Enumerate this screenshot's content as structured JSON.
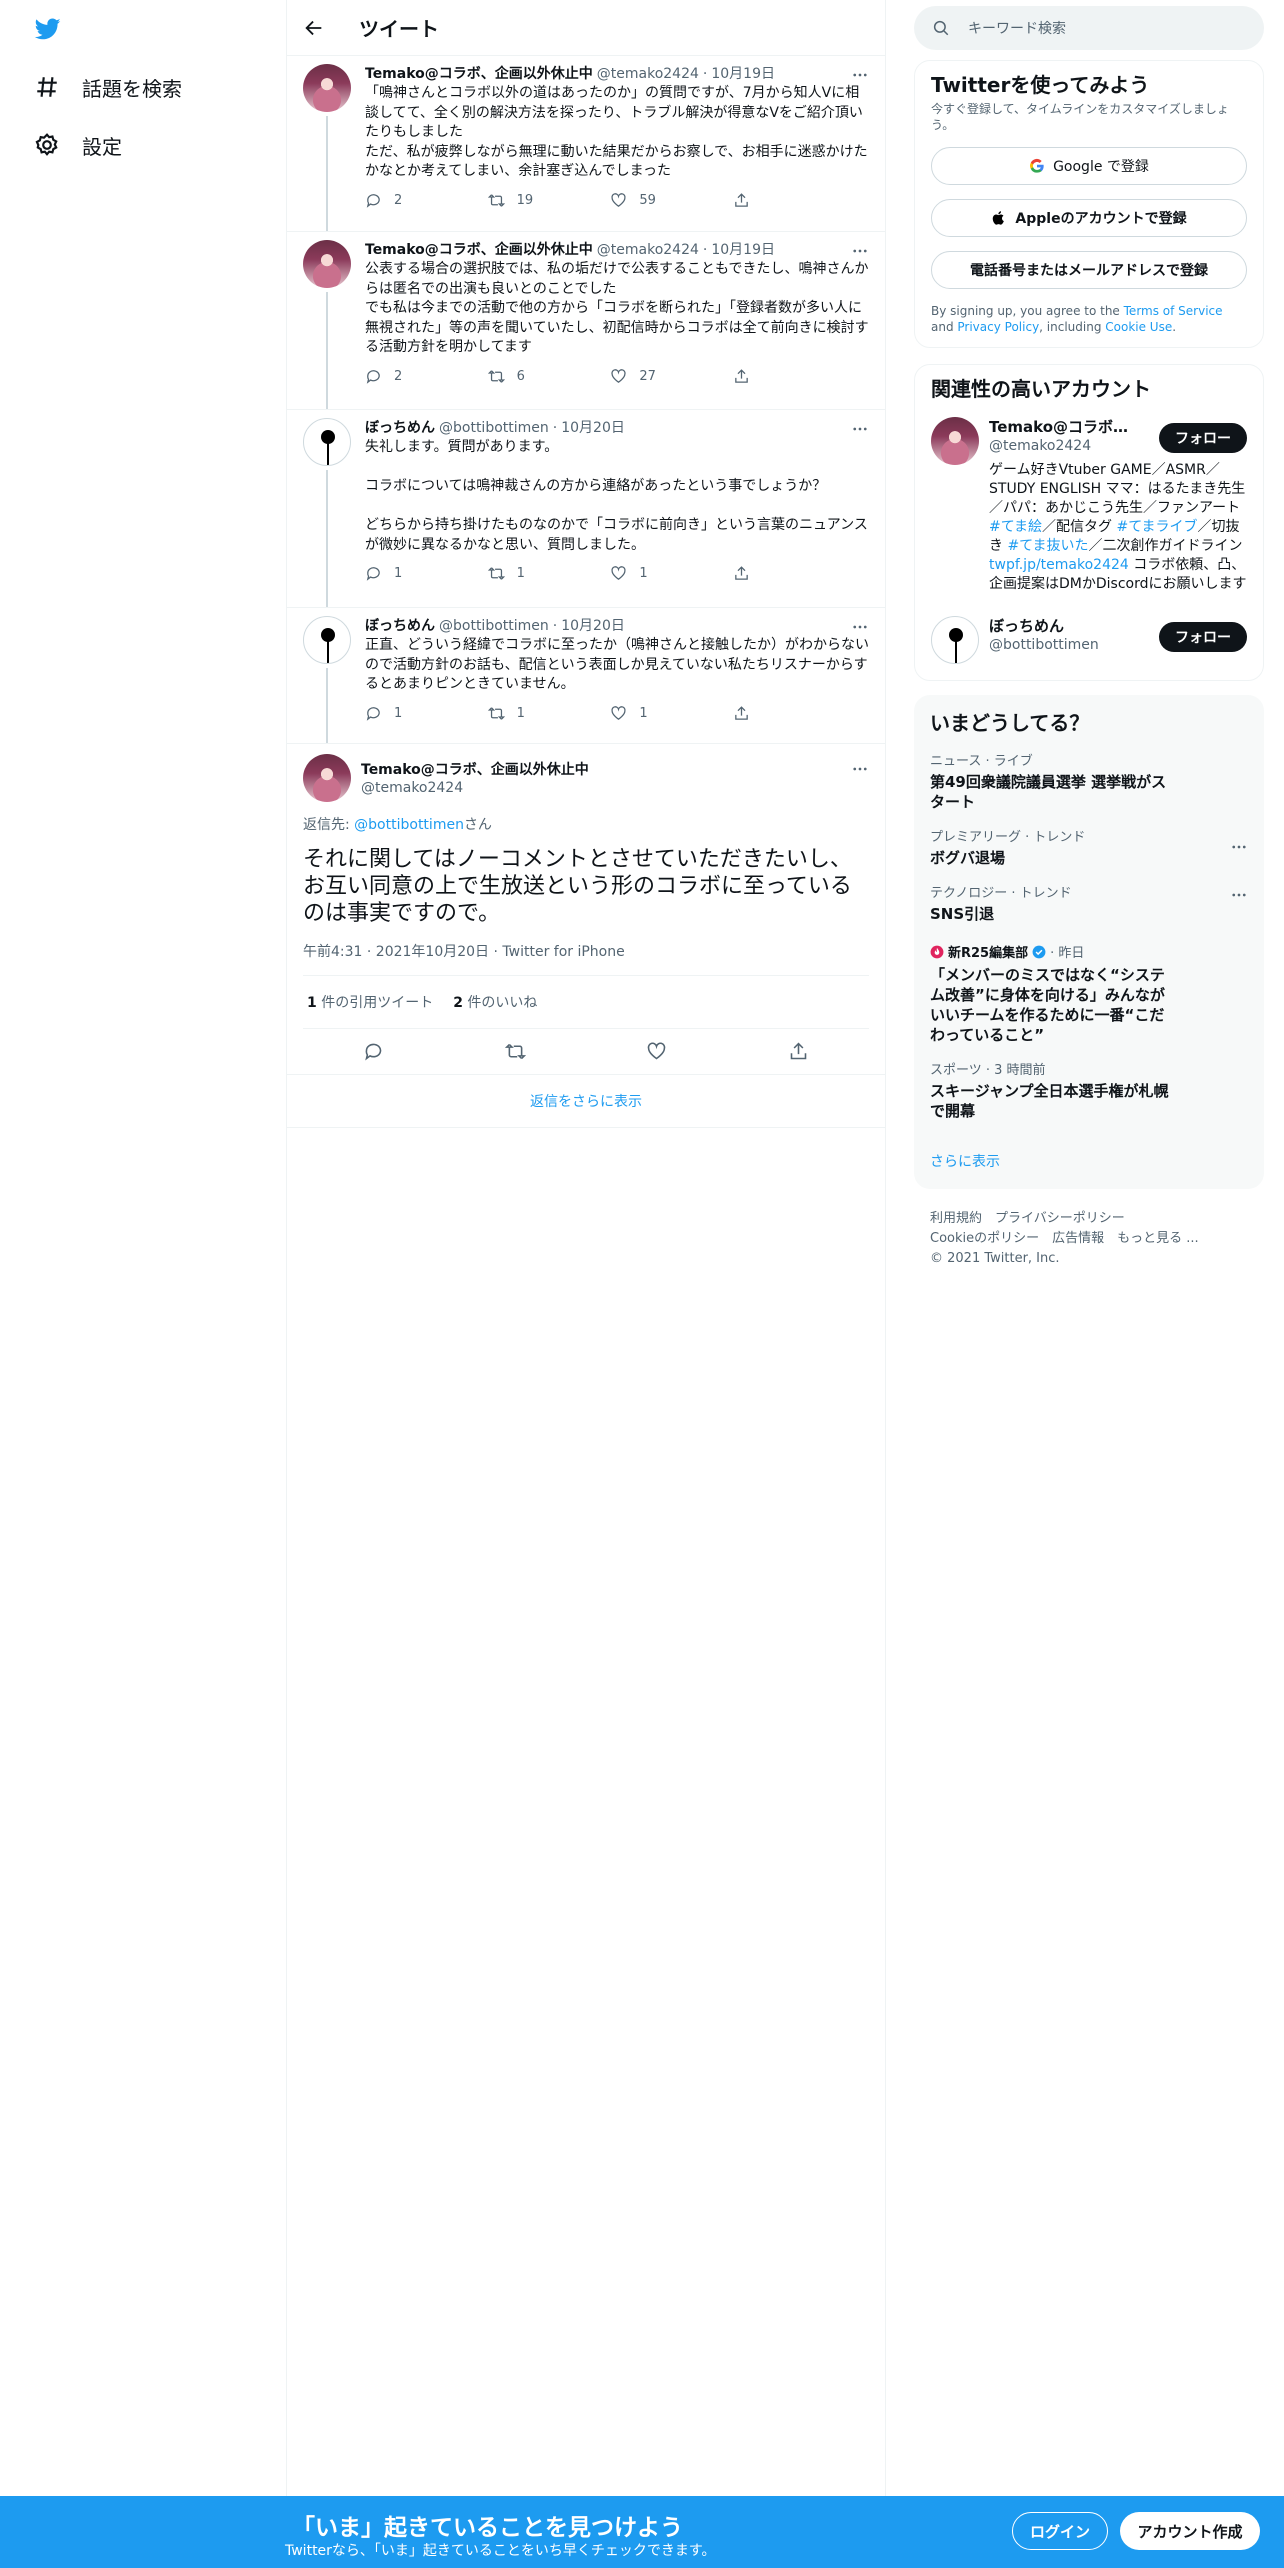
{
  "nav": {
    "explore_label": "話題を検索",
    "settings_label": "設定"
  },
  "header": {
    "title": "ツイート"
  },
  "tweets": [
    {
      "name": "Temako@コラボ、企画以外休止中",
      "handle": "@temako2424",
      "date": "10月19日",
      "text": "「鳴神さんとコラボ以外の道はあったのか」の質問ですが、7月から知人Vに相談してて、全く別の解決方法を探ったり、トラブル解決が得意なVをご紹介頂いたりもしました\nただ、私が疲弊しながら無理に動いた結果だからお察しで、お相手に迷惑かけたかなとか考えてしまい、余計塞ぎ込んでしまった",
      "replies": "2",
      "retweets": "19",
      "likes": "59"
    },
    {
      "name": "Temako@コラボ、企画以外休止中",
      "handle": "@temako2424",
      "date": "10月19日",
      "text": "公表する場合の選択肢では、私の垢だけで公表することもできたし、鳴神さんからは匿名での出演も良いとのことでした\nでも私は今までの活動で他の方から「コラボを断られた」「登録者数が多い人に無視された」等の声を聞いていたし、初配信時からコラボは全て前向きに検討する活動方針を明かしてます",
      "replies": "2",
      "retweets": "6",
      "likes": "27"
    },
    {
      "name": "ぼっちめん",
      "handle": "@bottibottimen",
      "date": "10月20日",
      "text": "失礼します。質問があります。\n\nコラボについては鳴神裁さんの方から連絡があったという事でしょうか？\n\nどちらから持ち掛けたものなのかで「コラボに前向き」という言葉のニュアンスが微妙に異なるかなと思い、質問しました。",
      "replies": "1",
      "retweets": "1",
      "likes": "1"
    },
    {
      "name": "ぼっちめん",
      "handle": "@bottibottimen",
      "date": "10月20日",
      "text": "正直、どういう経緯でコラボに至ったか（鳴神さんと接触したか）がわからないので活動方針のお話も、配信という表面しか見えていない私たちリスナーからするとあまりピンときていません。",
      "replies": "1",
      "retweets": "1",
      "likes": "1"
    }
  ],
  "focus": {
    "name": "Temako@コラボ、企画以外休止中",
    "handle": "@temako2424",
    "reply_prefix": "返信先: ",
    "reply_to": "@bottibottimen",
    "reply_suffix": "さん",
    "text": "それに関してはノーコメントとさせていただきたいし、お互い同意の上で生放送という形のコラボに至っているのは事実ですので。",
    "meta": "午前4:31 · 2021年10月20日 · Twitter for iPhone",
    "quotes_count": "1",
    "quotes_label": "件の引用ツイート",
    "likes_count": "2",
    "likes_label": "件のいいね",
    "show_more": "返信をさらに表示"
  },
  "search": {
    "placeholder": "キーワード検索"
  },
  "signup_card": {
    "title": "Twitterを使ってみよう",
    "subtitle": "今すぐ登録して、タイムラインをカスタマイズしましょう。",
    "google": "Google で登録",
    "apple": "Appleのアカウントで登録",
    "phone": "電話番号またはメールアドレスで登録",
    "legal_1": "By signing up, you agree to the ",
    "terms": "Terms of Service",
    "legal_2": " and ",
    "privacy": "Privacy Policy",
    "legal_3": ", including ",
    "cookie": "Cookie Use",
    "legal_4": "."
  },
  "related": {
    "title": "関連性の高いアカウント",
    "follow_label": "フォロー",
    "accounts": [
      {
        "name": "Temako@コラボ、企...",
        "handle": "@temako2424",
        "bio_1": "ゲーム好きVtuber GAME／ASMR／STUDY ENGLISH ママ：はるたまき先生／パパ：あかじこう先生／ファンアート ",
        "tag_1": "#てま絵",
        "bio_2": "／配信タグ ",
        "tag_2": "#てまライブ",
        "bio_3": "／切抜き ",
        "tag_3": "#てま抜いた",
        "bio_4": "／二次創作ガイドライン",
        "link": "twpf.jp/temako2424",
        "bio_5": " コラボ依頼、凸、企画提案はDMかDiscordにお願いします"
      },
      {
        "name": "ぼっちめん",
        "handle": "@bottibottimen"
      }
    ]
  },
  "trends": {
    "title": "いまどうしてる？",
    "items": [
      {
        "category": "ニュース · ライブ",
        "title": "第49回衆議院議員選挙 選挙戦がスタート"
      },
      {
        "category": "プレミアリーグ · トレンド",
        "title": "ボグバ退場"
      },
      {
        "category": "テクノロジー · トレンド",
        "title": "SNS引退"
      },
      {
        "author": "新R25編集部",
        "time": "· 昨日",
        "title": "「メンバーのミスではなく“システム改善”に身体を向ける」みんながいいチームを作るために一番“こだわっていること”"
      },
      {
        "category": "スポーツ · 3 時間前",
        "title": "スキージャンプ全日本選手権が札幌で開幕"
      }
    ],
    "show_more": "さらに表示"
  },
  "footer": {
    "line1": "利用規約　プライバシーポリシー",
    "line2": "Cookieのポリシー　広告情報　もっと見る ...",
    "line3": "© 2021 Twitter, Inc."
  },
  "banner": {
    "title": "「いま」起きていることを見つけよう",
    "subtitle": "Twitterなら、「いま」起きていることをいち早くチェックできます。",
    "login": "ログイン",
    "signup": "アカウント作成"
  },
  "colors": {
    "accent": "#1d9bf0",
    "text": "#0f1419",
    "muted": "#536471"
  }
}
